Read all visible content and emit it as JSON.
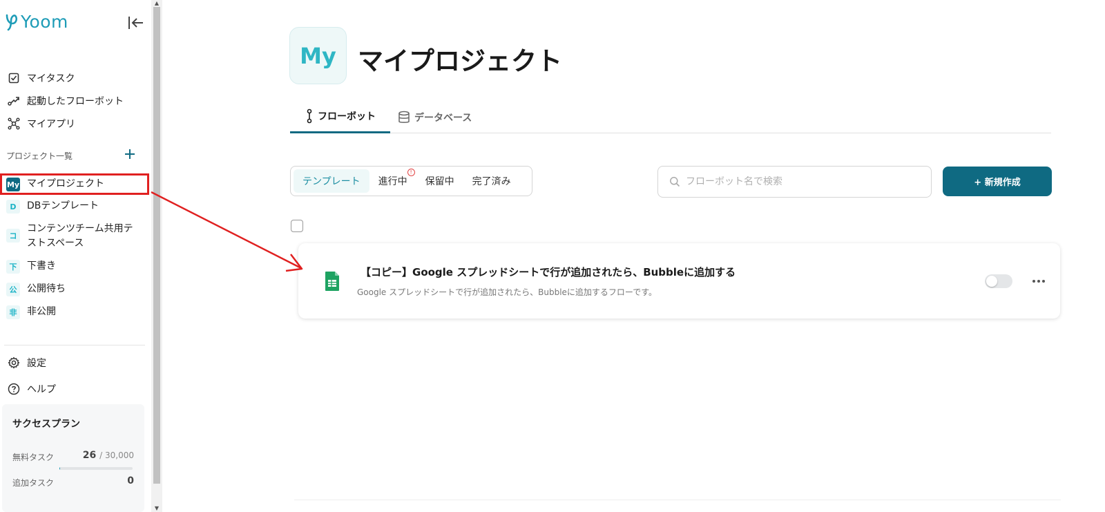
{
  "app": {
    "logo_text": "Yoom"
  },
  "sidebar": {
    "nav": [
      {
        "label": "マイタスク",
        "icon": "checkbox-icon"
      },
      {
        "label": "起動したフローボット",
        "icon": "flow-icon"
      },
      {
        "label": "マイアプリ",
        "icon": "apps-icon"
      }
    ],
    "projects_label": "プロジェクト一覧",
    "projects": [
      {
        "badge": "My",
        "label": "マイプロジェクト",
        "active": true
      },
      {
        "badge": "D",
        "label": "DBテンプレート"
      },
      {
        "badge": "コ",
        "label": "コンテンツチーム共用テストスペース"
      },
      {
        "badge": "下",
        "label": "下書き"
      },
      {
        "badge": "公",
        "label": "公開待ち"
      },
      {
        "badge": "非",
        "label": "非公開"
      }
    ],
    "bottom_nav": [
      {
        "label": "設定",
        "icon": "gear-icon"
      },
      {
        "label": "ヘルプ",
        "icon": "help-icon"
      }
    ],
    "plan": {
      "title": "サクセスプラン",
      "free_tasks_label": "無料タスク",
      "free_tasks_used": "26",
      "free_tasks_total": "/ 30,000",
      "free_tasks_fraction": 0.00087,
      "extra_tasks_label": "追加タスク",
      "extra_tasks_value": "0"
    }
  },
  "main": {
    "avatar": "My",
    "title": "マイプロジェクト",
    "tabs": [
      {
        "label": "フローボット",
        "active": true
      },
      {
        "label": "データベース"
      }
    ],
    "filters": [
      {
        "label": "テンプレート",
        "active": true
      },
      {
        "label": "進行中",
        "alert": "!"
      },
      {
        "label": "保留中"
      },
      {
        "label": "完了済み"
      }
    ],
    "search": {
      "placeholder": "フローボット名で検索"
    },
    "new_button": "+ 新規作成",
    "flowbots": [
      {
        "title": "【コピー】Google スプレッドシートで行が追加されたら、Bubbleに追加する",
        "description": "Google スプレッドシートで行が追加されたら、Bubbleに追加するフローです。",
        "icon": "google-sheets-icon",
        "enabled": false
      }
    ]
  },
  "colors": {
    "accent": "#0f6a82",
    "brand": "#1e9cb7",
    "annotation_red": "#e02020"
  }
}
